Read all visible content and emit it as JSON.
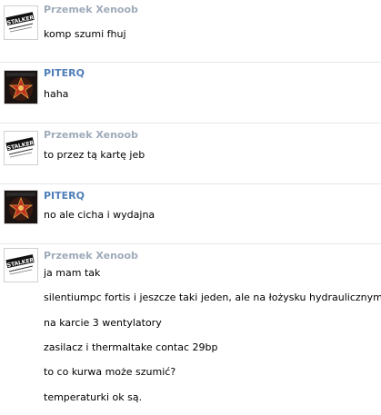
{
  "colors": {
    "sender_przemek": "#9fabba",
    "sender_piterq": "#4f7fb8",
    "divider": "#e4e8ed"
  },
  "messages": [
    {
      "sender": "Przemek Xenoob",
      "avatar": "stalker-logo-avatar",
      "lines": [
        "komp szumi fhuj"
      ]
    },
    {
      "sender": "PITERQ",
      "avatar": "star-emblem-avatar",
      "lines": [
        "haha"
      ]
    },
    {
      "sender": "Przemek Xenoob",
      "avatar": "stalker-logo-avatar",
      "lines": [
        "to przez tą kartę jeb"
      ]
    },
    {
      "sender": "PITERQ",
      "avatar": "star-emblem-avatar",
      "lines": [
        "no ale cicha i wydajna"
      ]
    },
    {
      "sender": "Przemek Xenoob",
      "avatar": "stalker-logo-avatar",
      "lines": [
        "ja mam tak",
        "silentiumpc fortis i jeszcze taki jeden, ale na łożysku hydraulicznym",
        "na karcie 3 wentylatory",
        "zasilacz i thermaltake contac 29bp",
        "to co kurwa może szumić?",
        "temperaturki ok są."
      ]
    }
  ]
}
